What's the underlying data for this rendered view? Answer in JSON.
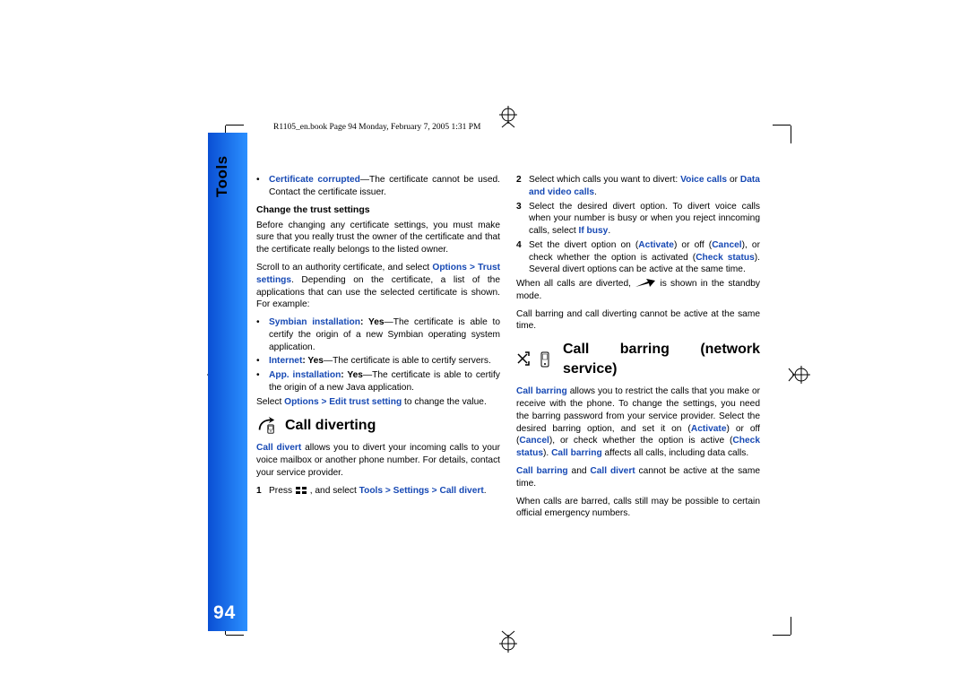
{
  "header": "R1105_en.book  Page 94  Monday, February 7, 2005  1:31 PM",
  "sidebar": {
    "label": "Tools",
    "page_number": "94"
  },
  "left": {
    "bullet_cert_corrupt": {
      "label": "Certificate corrupted",
      "body": "—The certificate cannot be used. Contact the certificate issuer."
    },
    "sub_change": "Change the trust settings",
    "p_before_change": "Before changing any certificate settings, you must make sure that you really trust the owner of the certificate and that the certificate really belongs to the listed owner.",
    "p_scroll_a": "Scroll to an authority certificate, and select ",
    "p_scroll_link": "Options > Trust settings",
    "p_scroll_b": ". Depending on the certificate, a list of the applications that can use the selected certificate is shown. For example:",
    "b_symbian": {
      "label": "Symbian installation",
      "yn": ": Yes",
      "body": "—The certificate is able to certify the origin of a new Symbian operating system application."
    },
    "b_internet": {
      "label": "Internet",
      "yn": ": Yes",
      "body": "—The certificate is able to certify servers."
    },
    "b_app": {
      "label": "App. installation",
      "yn": ": Yes",
      "body": "—The certificate is able to certify the origin of a new Java application."
    },
    "p_select_a": "Select ",
    "p_select_link": "Options > Edit trust setting",
    "p_select_b": " to change the value.",
    "h_divert": "Call diverting",
    "p_divert_intro_a": "Call divert",
    "p_divert_intro_b": " allows you to divert your incoming calls to your voice mailbox or another phone number. For details, contact your service provider.",
    "step1_a": "Press ",
    "step1_b": " , and select ",
    "step1_link": "Tools > Settings > Call divert",
    "step1_c": "."
  },
  "right": {
    "step2_a": "Select which calls you want to divert: ",
    "step2_voice": "Voice calls",
    "step2_b": " or ",
    "step2_data": "Data and video calls",
    "step2_c": ".",
    "step3_a": "Select the desired divert option. To divert voice calls when your number is busy or when you reject inncoming calls, select ",
    "step3_link": "If busy",
    "step3_b": ".",
    "step4_a": "Set the divert option on (",
    "step4_activate": "Activate",
    "step4_b": ") or off (",
    "step4_cancel": "Cancel",
    "step4_c": "), or check whether the option is activated (",
    "step4_check": "Check status",
    "step4_d": "). Several divert options can be active at the same time.",
    "p_when_all_a": "When all calls are diverted, ",
    "p_when_all_b": " is shown in the standby mode.",
    "p_not_both": "Call barring and call diverting cannot be active at the same time.",
    "h_barring": "Call barring (network service)",
    "p_bar_a": "Call barring",
    "p_bar_b": " allows you to restrict the calls that you make or receive with the phone. To change the settings, you need the barring password from your service provider. Select the desired barring option, and set it on (",
    "p_bar_activate": "Activate",
    "p_bar_c": ") or off (",
    "p_bar_cancel": "Cancel",
    "p_bar_d": "), or check whether the option is active (",
    "p_bar_check": "Check status",
    "p_bar_e": "). ",
    "p_bar_f": "Call barring",
    "p_bar_g": " affects all calls, including data calls.",
    "p_bar2_a": "Call barring",
    "p_bar2_b": " and ",
    "p_bar2_c": "Call divert",
    "p_bar2_d": " cannot be active at the same time.",
    "p_emerg": "When calls are barred, calls still may be possible to certain official emergency numbers."
  }
}
